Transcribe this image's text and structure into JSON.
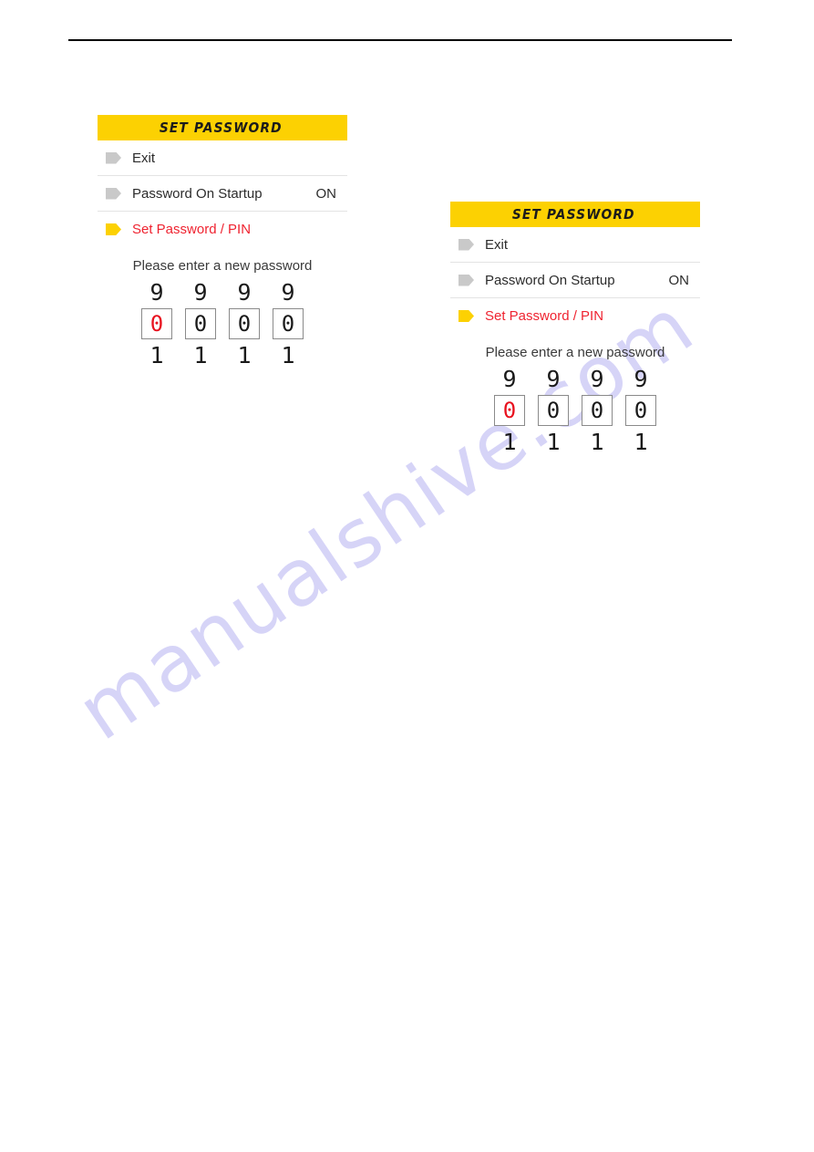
{
  "page": {
    "background_color": "#ffffff",
    "header_rule": true
  },
  "watermark": {
    "text": "manualshive.com",
    "color": "#c9c6f5"
  },
  "colors": {
    "title_bar_yellow": "#fcd102",
    "accent_red": "#ef2330",
    "marker_gray": "#c9c9c9",
    "selected_digit_red": "#e8121f",
    "text_dark": "#2b2b2b",
    "divider_gray": "#e3e3e3"
  },
  "screens": [
    {
      "id": "screen-left",
      "title": "SET PASSWORD",
      "menu": [
        {
          "label": "Exit",
          "value": "",
          "selected": false
        },
        {
          "label": "Password On Startup",
          "value": "ON",
          "selected": false
        },
        {
          "label": "Set Password / PIN",
          "value": "",
          "selected": true
        }
      ],
      "prompt": "Please enter a new password",
      "digits": [
        {
          "above": "9",
          "value": "0",
          "below": "1",
          "selected": true
        },
        {
          "above": "9",
          "value": "0",
          "below": "1",
          "selected": false
        },
        {
          "above": "9",
          "value": "0",
          "below": "1",
          "selected": false
        },
        {
          "above": "9",
          "value": "0",
          "below": "1",
          "selected": false
        }
      ]
    },
    {
      "id": "screen-right",
      "title": "SET PASSWORD",
      "menu": [
        {
          "label": "Exit",
          "value": "",
          "selected": false
        },
        {
          "label": "Password On Startup",
          "value": "ON",
          "selected": false
        },
        {
          "label": "Set Password / PIN",
          "value": "",
          "selected": true
        }
      ],
      "prompt": "Please enter a new password",
      "digits": [
        {
          "above": "9",
          "value": "0",
          "below": "1",
          "selected": true
        },
        {
          "above": "9",
          "value": "0",
          "below": "1",
          "selected": false
        },
        {
          "above": "9",
          "value": "0",
          "below": "1",
          "selected": false
        },
        {
          "above": "9",
          "value": "0",
          "below": "1",
          "selected": false
        }
      ]
    }
  ]
}
